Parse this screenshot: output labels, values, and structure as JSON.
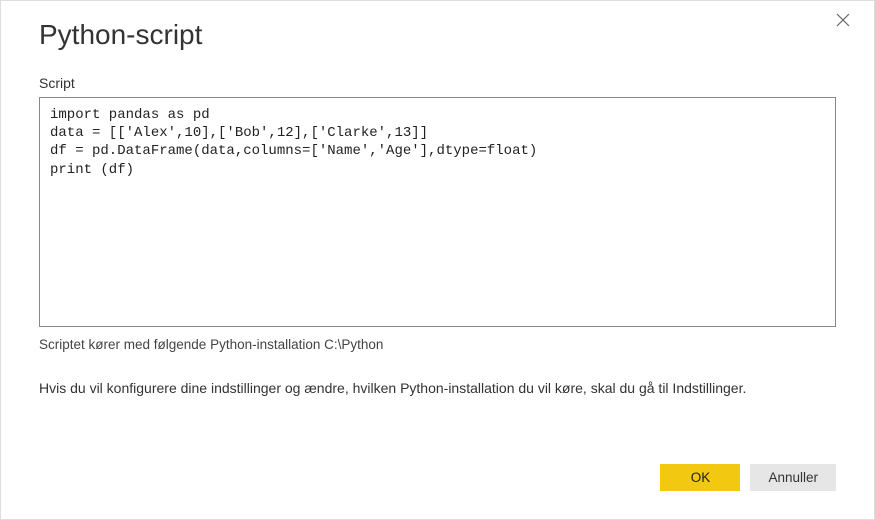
{
  "dialog": {
    "title": "Python-script",
    "field_label": "Script",
    "script_text": "import pandas as pd\ndata = [['Alex',10],['Bob',12],['Clarke',13]]\ndf = pd.DataFrame(data,columns=['Name','Age'],dtype=float)\nprint (df)",
    "install_note": "Scriptet kører med følgende Python-installation C:\\Python",
    "help_text": "Hvis du vil konfigurere dine indstillinger og ændre, hvilken Python-installation du vil køre, skal du gå til Indstillinger.",
    "buttons": {
      "ok": "OK",
      "cancel": "Annuller"
    }
  }
}
